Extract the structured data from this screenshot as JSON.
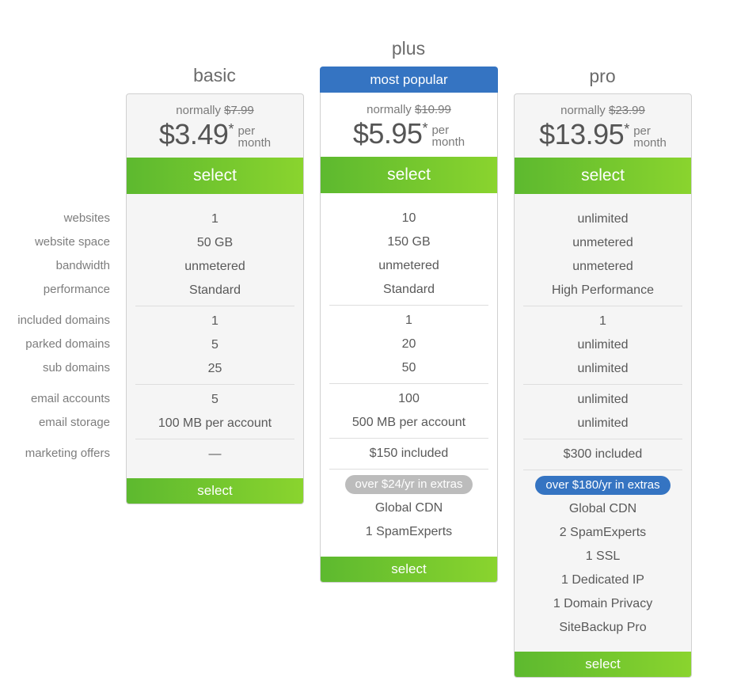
{
  "feature_labels": [
    "websites",
    "website space",
    "bandwidth",
    "performance",
    "included domains",
    "parked domains",
    "sub domains",
    "email accounts",
    "email storage",
    "marketing offers"
  ],
  "colors": {
    "accent_blue": "#3574c2",
    "select_green_start": "#5db92f",
    "select_green_end": "#8ad42e",
    "extras_pill_gray": "#bcbcbc"
  },
  "plans": [
    {
      "name": "basic",
      "normally_label": "normally",
      "original_price": "$7.99",
      "price": "$3.49",
      "asterisk": "*",
      "per": "per",
      "period": "month",
      "select_label": "select",
      "websites": "1",
      "website_space": "50 GB",
      "bandwidth": "unmetered",
      "performance": "Standard",
      "included_domains": "1",
      "parked_domains": "5",
      "sub_domains": "25",
      "email_accounts": "5",
      "email_storage": "100 MB per account",
      "marketing_offers": "—",
      "bottom_select_label": "select"
    },
    {
      "name": "plus",
      "badge": "most popular",
      "normally_label": "normally",
      "original_price": "$10.99",
      "price": "$5.95",
      "asterisk": "*",
      "per": "per",
      "period": "month",
      "select_label": "select",
      "websites": "10",
      "website_space": "150 GB",
      "bandwidth": "unmetered",
      "performance": "Standard",
      "included_domains": "1",
      "parked_domains": "20",
      "sub_domains": "50",
      "email_accounts": "100",
      "email_storage": "500 MB per account",
      "marketing_offers": "$150 included",
      "extras_pill": "over $24/yr in extras",
      "extras": [
        "Global CDN",
        "1 SpamExperts"
      ],
      "bottom_select_label": "select"
    },
    {
      "name": "pro",
      "normally_label": "normally",
      "original_price": "$23.99",
      "price": "$13.95",
      "asterisk": "*",
      "per": "per",
      "period": "month",
      "select_label": "select",
      "websites": "unlimited",
      "website_space": "unmetered",
      "bandwidth": "unmetered",
      "performance": "High Performance",
      "included_domains": "1",
      "parked_domains": "unlimited",
      "sub_domains": "unlimited",
      "email_accounts": "unlimited",
      "email_storage": "unlimited",
      "marketing_offers": "$300 included",
      "extras_pill": "over $180/yr in extras",
      "extras": [
        "Global CDN",
        "2 SpamExperts",
        "1 SSL",
        "1 Dedicated IP",
        "1 Domain Privacy",
        "SiteBackup Pro"
      ],
      "bottom_select_label": "select"
    }
  ]
}
